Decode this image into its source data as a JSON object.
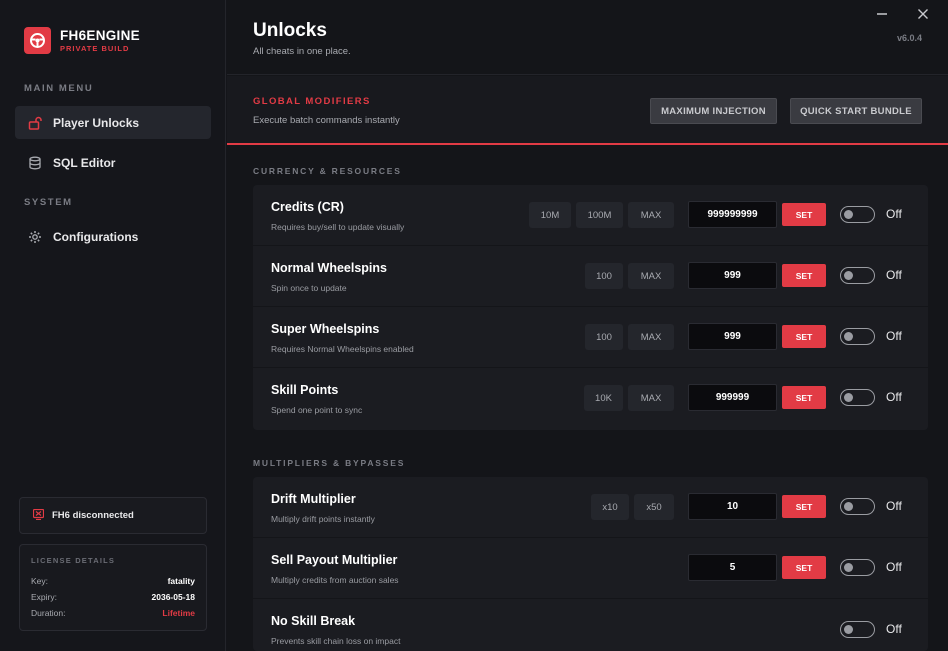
{
  "brand": {
    "name": "FH6ENGINE",
    "subtitle": "PRIVATE BUILD"
  },
  "sidebar": {
    "main_menu_label": "MAIN MENU",
    "system_label": "SYSTEM",
    "items": [
      {
        "label": "Player Unlocks",
        "icon": "unlock-icon",
        "active": true
      },
      {
        "label": "SQL Editor",
        "icon": "database-icon",
        "active": false
      },
      {
        "label": "Configurations",
        "icon": "gear-icon",
        "active": false
      }
    ],
    "status": {
      "text": "FH6 disconnected",
      "icon": "disconnected-icon"
    },
    "license": {
      "title": "LICENSE DETAILS",
      "rows": [
        {
          "key": "Key:",
          "value": "fatality"
        },
        {
          "key": "Expiry:",
          "value": "2036-05-18"
        },
        {
          "key": "Duration:",
          "value": "Lifetime"
        }
      ]
    }
  },
  "header": {
    "title": "Unlocks",
    "subtitle": "All cheats in one place.",
    "version": "v6.0.4"
  },
  "global": {
    "title": "GLOBAL MODIFIERS",
    "subtitle": "Execute batch commands instantly",
    "buttons": [
      "MAXIMUM INJECTION",
      "QUICK START BUNDLE"
    ]
  },
  "sections": [
    {
      "label": "CURRENCY & RESOURCES",
      "rows": [
        {
          "title": "Credits (CR)",
          "subtitle": "Requires buy/sell to update visually",
          "presets": [
            "10M",
            "100M",
            "MAX"
          ],
          "value": "999999999",
          "set": "SET",
          "toggle": "Off"
        },
        {
          "title": "Normal Wheelspins",
          "subtitle": "Spin once to update",
          "presets": [
            "100",
            "MAX"
          ],
          "value": "999",
          "set": "SET",
          "toggle": "Off"
        },
        {
          "title": "Super Wheelspins",
          "subtitle": "Requires Normal Wheelspins enabled",
          "presets": [
            "100",
            "MAX"
          ],
          "value": "999",
          "set": "SET",
          "toggle": "Off"
        },
        {
          "title": "Skill Points",
          "subtitle": "Spend one point to sync",
          "presets": [
            "10K",
            "MAX"
          ],
          "value": "999999",
          "set": "SET",
          "toggle": "Off"
        }
      ]
    },
    {
      "label": "MULTIPLIERS & BYPASSES",
      "rows": [
        {
          "title": "Drift Multiplier",
          "subtitle": "Multiply drift points instantly",
          "presets": [
            "x10",
            "x50"
          ],
          "value": "10",
          "set": "SET",
          "toggle": "Off"
        },
        {
          "title": "Sell Payout Multiplier",
          "subtitle": "Multiply credits from auction sales",
          "presets": [],
          "value": "5",
          "set": "SET",
          "toggle": "Off"
        },
        {
          "title": "No Skill Break",
          "subtitle": "Prevents skill chain loss on impact",
          "presets": [],
          "value": "",
          "set": "",
          "toggle": "Off"
        }
      ]
    }
  ],
  "colors": {
    "accent": "#e23b45",
    "background": "#14151a",
    "panel": "#1b1c21"
  }
}
